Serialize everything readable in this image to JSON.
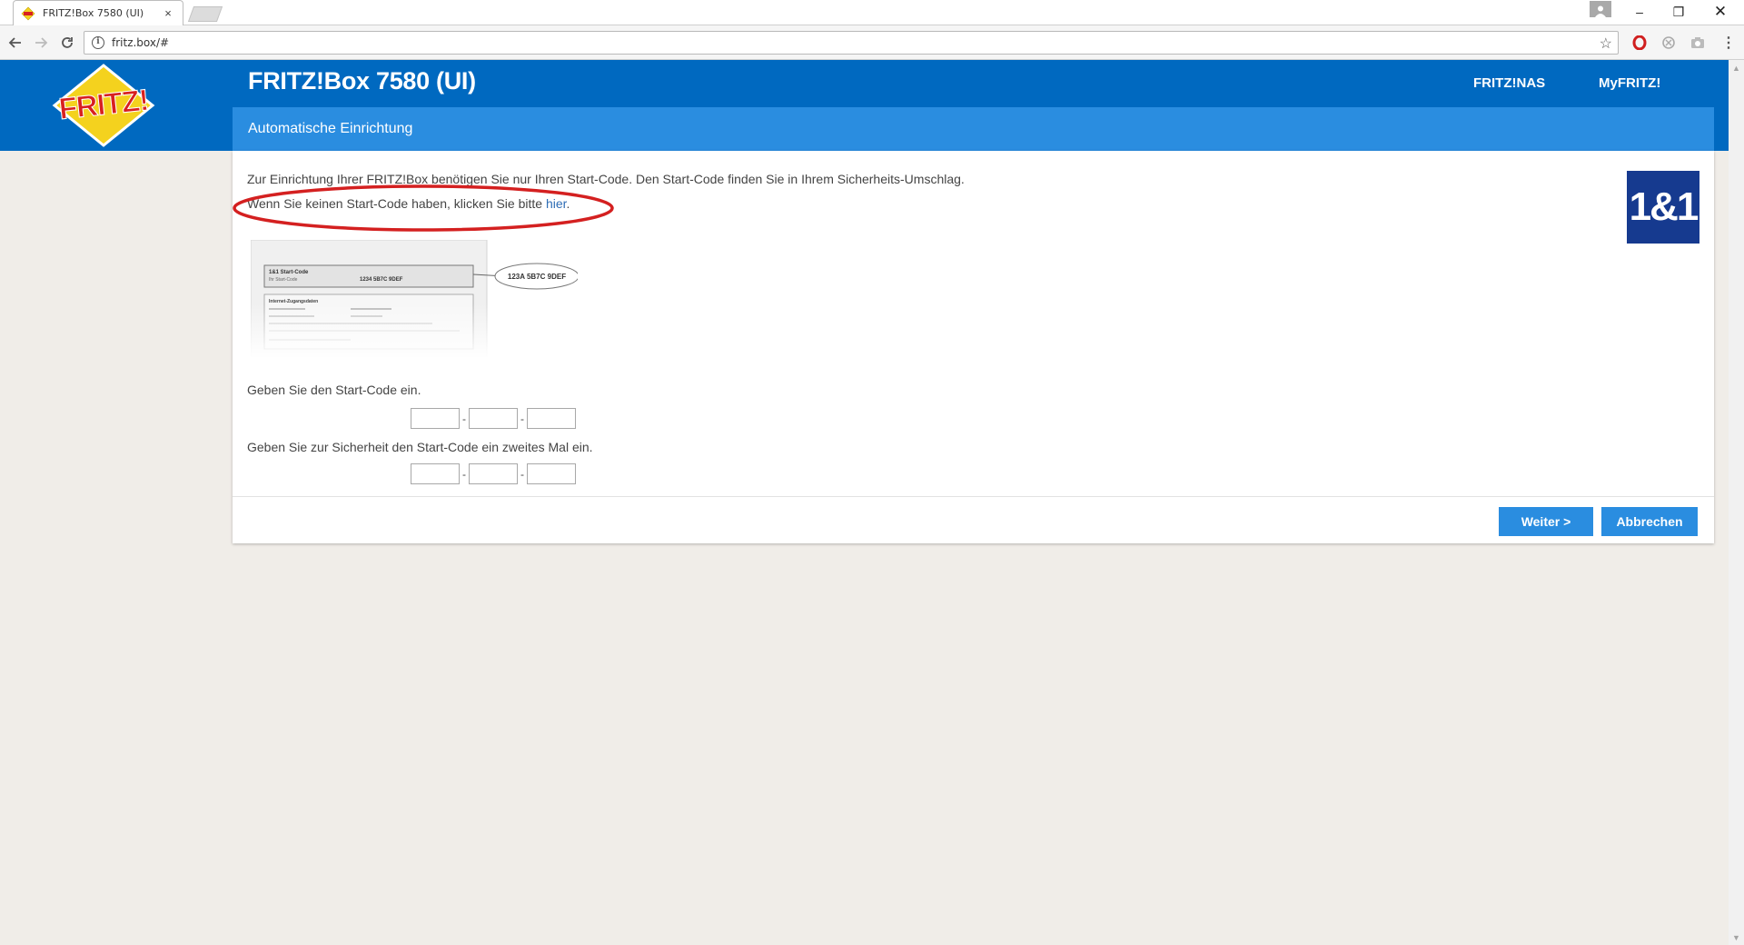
{
  "browser": {
    "tab_title": "FRITZ!Box 7580 (UI)",
    "tab_close": "×",
    "url": "fritz.box/#",
    "window_controls": {
      "minimize": "–",
      "restore": "❐",
      "close": "✕"
    },
    "icons": [
      "fritz-favicon",
      "profile-icon",
      "back-icon",
      "forward-icon",
      "reload-icon",
      "info-icon",
      "star-icon",
      "opera-icon",
      "extension-icon",
      "camera-icon",
      "menu-icon",
      "scroll-up-icon",
      "scroll-down-icon"
    ]
  },
  "header": {
    "title": "FRITZ!Box 7580 (UI)",
    "links": [
      "FRITZ!NAS",
      "MyFRITZ!"
    ],
    "logo_text": "FRITZ!",
    "background_color": "#0069c0"
  },
  "subheader": {
    "title": "Automatische Einrichtung",
    "background_color": "#2a8de0"
  },
  "content": {
    "intro_line1": "Zur Einrichtung Ihrer FRITZ!Box benötigen Sie nur Ihren Start-Code. Den Start-Code finden Sie in Ihrem Sicherheits-Umschlag.",
    "intro_line2_prefix": "Wenn Sie keinen Start-Code haben, klicken Sie bitte ",
    "intro_line2_link": "hier",
    "intro_line2_suffix": ".",
    "provider_logo": "1&1",
    "illustration": {
      "callout_code": "123A  5B7C  9DEF",
      "section_title": "1&1 Start-Code",
      "section_subtitle": "Ihr Start-Code",
      "section_code": "1234  5B7C  9DEF",
      "section2_title": "Internet-Zugangsdaten"
    },
    "label_code": "Geben Sie den Start-Code ein.",
    "label_code_repeat": "Geben Sie zur Sicherheit den Start-Code ein zweites Mal ein.",
    "code_separator": "-",
    "code_fields": [
      "",
      "",
      ""
    ],
    "code_repeat_fields": [
      "",
      "",
      ""
    ]
  },
  "actions": {
    "next": "Weiter >",
    "cancel": "Abbrechen"
  },
  "annotation_color": "#d42020"
}
